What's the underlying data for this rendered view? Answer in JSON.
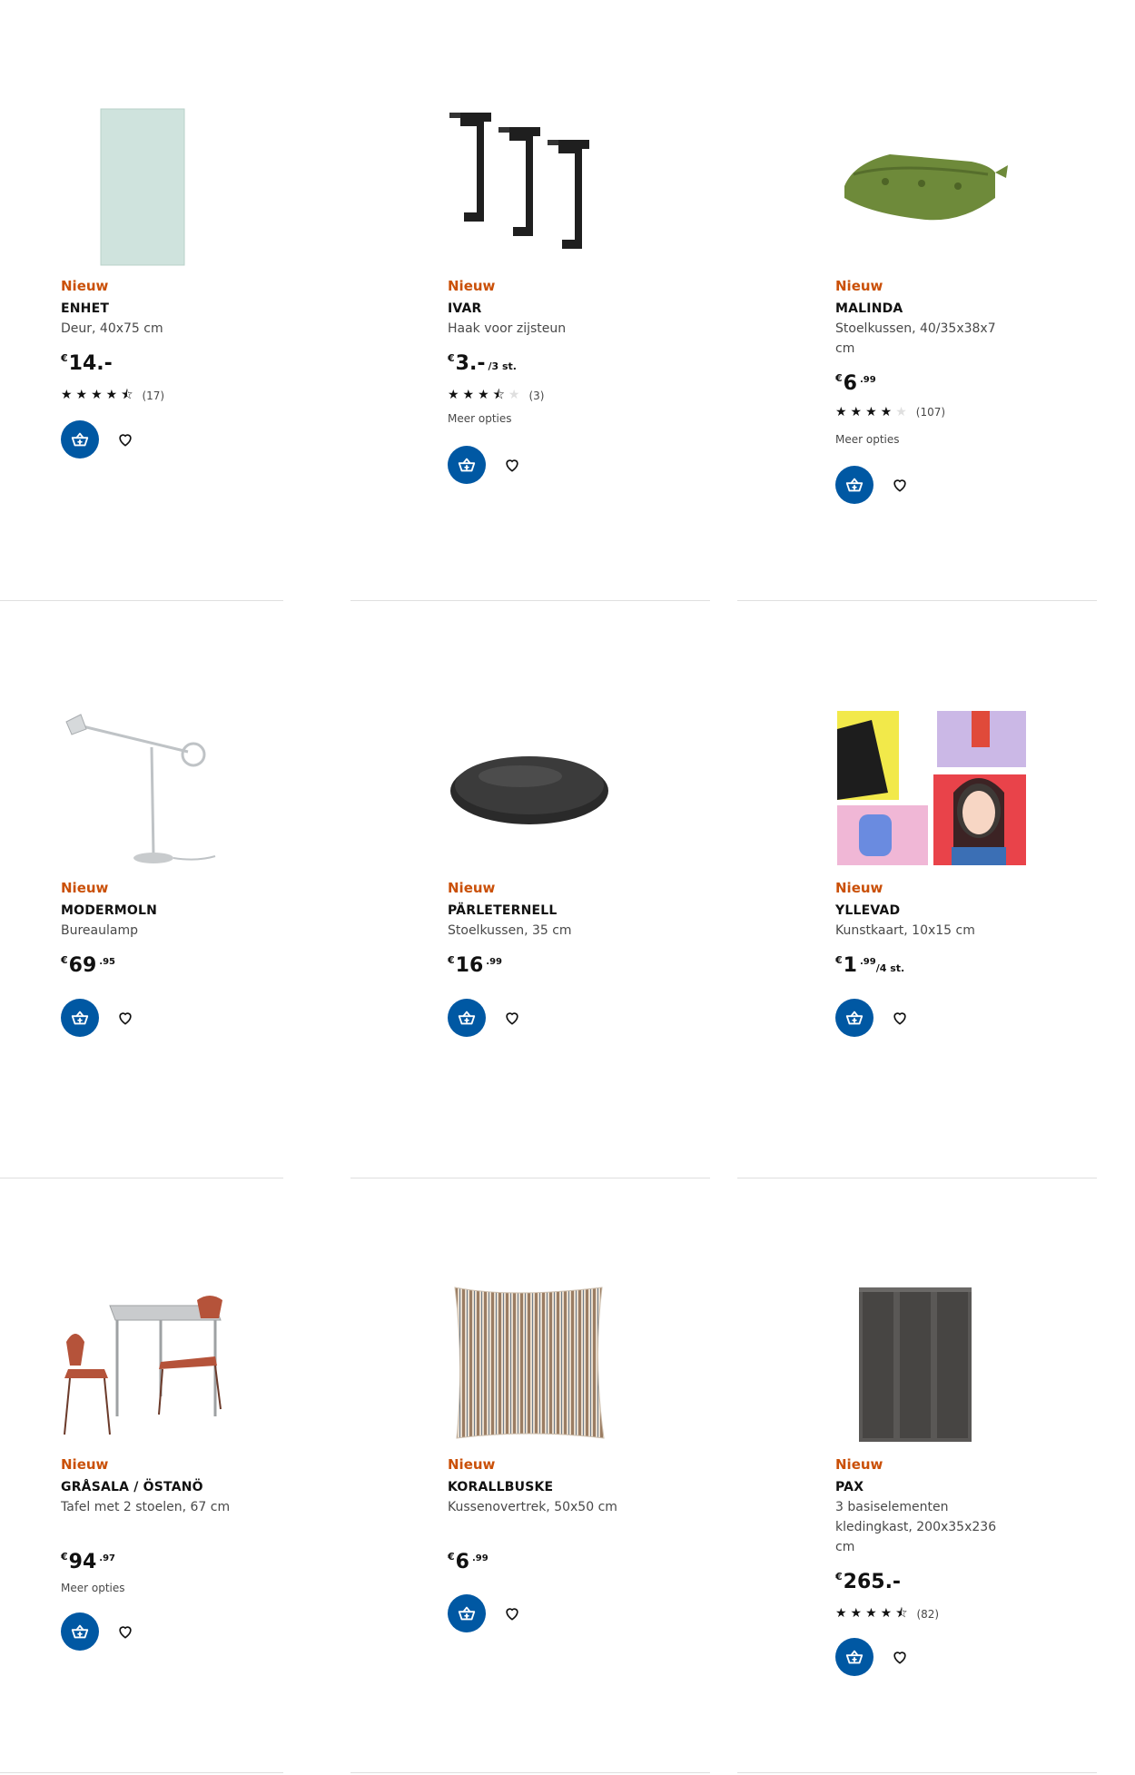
{
  "products": [
    {
      "badge": "Nieuw",
      "name": "ENHET",
      "desc": "Deur, 40x75 cm",
      "price_currency": "€",
      "price_int": "14.-",
      "price_dec": "",
      "price_unit": "",
      "stars": "★★★★⯪",
      "rating_count": "(17)",
      "more": ""
    },
    {
      "badge": "Nieuw",
      "name": "IVAR",
      "desc": "Haak voor zijsteun",
      "price_currency": "€",
      "price_int": "3.-",
      "price_dec": "",
      "price_unit": "/3 st.",
      "stars": "★★★⯪",
      "rating_count": "(3)",
      "more": "Meer opties"
    },
    {
      "badge": "Nieuw",
      "name": "MALINDA",
      "desc": "Stoelkussen, 40/35x38x7 cm",
      "price_currency": "€",
      "price_int": "6",
      "price_dec": ".99",
      "price_unit": "",
      "stars": "★★★★",
      "rating_count": "(107)",
      "more": "Meer opties"
    },
    {
      "badge": "Nieuw",
      "name": "MODERMOLN",
      "desc": "Bureaulamp",
      "price_currency": "€",
      "price_int": "69",
      "price_dec": ".95",
      "price_unit": "",
      "stars": "",
      "rating_count": "",
      "more": ""
    },
    {
      "badge": "Nieuw",
      "name": "PÄRLETERNELL",
      "desc": "Stoelkussen, 35 cm",
      "price_currency": "€",
      "price_int": "16",
      "price_dec": ".99",
      "price_unit": "",
      "stars": "",
      "rating_count": "",
      "more": ""
    },
    {
      "badge": "Nieuw",
      "name": "YLLEVAD",
      "desc": "Kunstkaart, 10x15 cm",
      "price_currency": "€",
      "price_int": "1",
      "price_dec": ".99",
      "price_unit": "/4 st.",
      "stars": "",
      "rating_count": "",
      "more": ""
    },
    {
      "badge": "Nieuw",
      "name": "GRÅSALA / ÖSTANÖ",
      "desc": "Tafel met 2 stoelen, 67 cm",
      "price_currency": "€",
      "price_int": "94",
      "price_dec": ".97",
      "price_unit": "",
      "stars": "",
      "rating_count": "",
      "more": "Meer opties"
    },
    {
      "badge": "Nieuw",
      "name": "KORALLBUSKE",
      "desc": "Kussenovertrek, 50x50 cm",
      "price_currency": "€",
      "price_int": "6",
      "price_dec": ".99",
      "price_unit": "",
      "stars": "",
      "rating_count": "",
      "more": ""
    },
    {
      "badge": "Nieuw",
      "name": "PAX",
      "desc": "3 basiselementen kledingkast, 200x35x236 cm",
      "price_currency": "€",
      "price_int": "265.-",
      "price_dec": "",
      "price_unit": "",
      "stars": "★★★★⯪",
      "rating_count": "(82)",
      "more": ""
    }
  ],
  "icons": {
    "cart": "add-to-cart-icon",
    "favourite": "heart-icon"
  },
  "colors": {
    "accent": "#0058a3",
    "new_badge": "#ca5008"
  }
}
